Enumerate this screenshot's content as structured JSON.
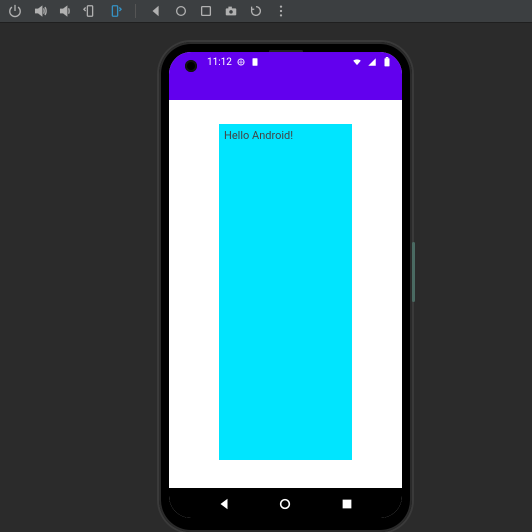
{
  "statusBar": {
    "time": "11:12"
  },
  "app": {
    "helloText": "Hello Android!"
  }
}
